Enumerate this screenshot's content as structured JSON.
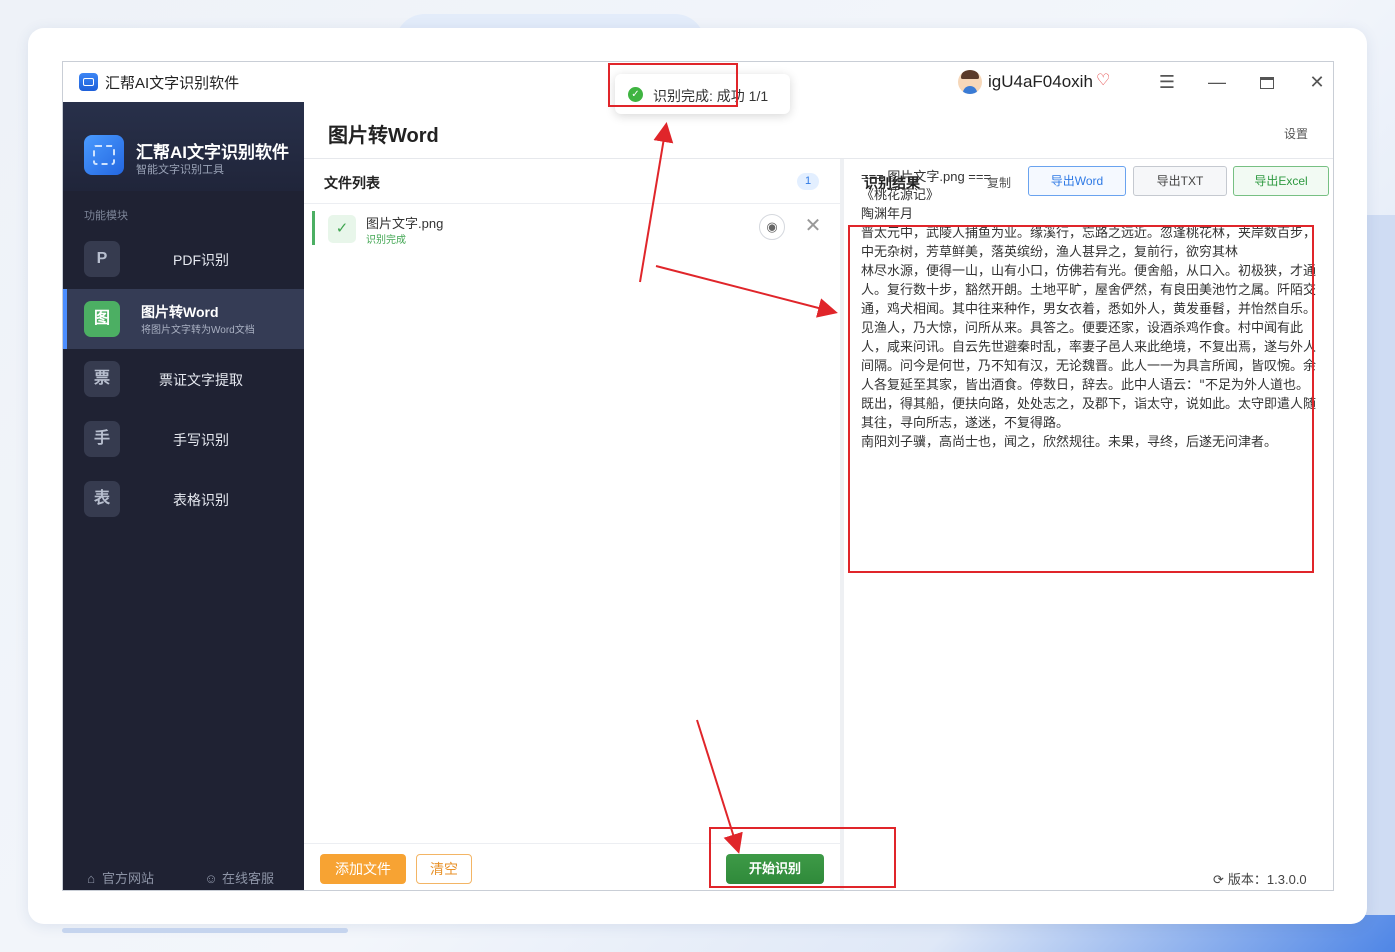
{
  "window": {
    "title": "汇帮AI文字识别软件",
    "username": "igU4aF04oxih"
  },
  "toast": {
    "text": "识别完成: 成功 1/1"
  },
  "sidebar": {
    "brand_title": "汇帮AI文字识别软件",
    "brand_subtitle": "智能文字识别工具",
    "section_label": "功能模块",
    "items": [
      {
        "badge": "P",
        "label": "PDF识别"
      },
      {
        "badge": "图",
        "label": "图片转Word",
        "sublabel": "将图片文字转为Word文档",
        "active": true
      },
      {
        "badge": "票",
        "label": "票证文字提取"
      },
      {
        "badge": "手",
        "label": "手写识别"
      },
      {
        "badge": "表",
        "label": "表格识别"
      }
    ],
    "footer": {
      "website": "官方网站",
      "support": "在线客服"
    }
  },
  "main": {
    "page_title": "图片转Word",
    "settings": "设置"
  },
  "file_list": {
    "title": "文件列表",
    "count": "1",
    "files": [
      {
        "name": "图片文字.png",
        "status": "识别完成"
      }
    ],
    "add_button": "添加文件",
    "clear_button": "清空",
    "start_button": "开始识别"
  },
  "result": {
    "title": "识别结果",
    "copy": "复制",
    "export_word": "导出Word",
    "export_txt": "导出TXT",
    "export_excel": "导出Excel",
    "lines": [
      "=== 图片文字.png ===",
      "《桃花源记》",
      "陶渊年月",
      "晋太元中，武陵人捕鱼为业。缘溪行，忘路之远近。忽逢桃花林，夹岸数百步，中无杂树，芳草鲜美，落英缤纷，渔人甚异之，复前行，欲穷其林",
      "林尽水源，便得一山，山有小口，仿佛若有光。便舍船，从口入。初极狭，才通人。复行数十步，豁然开朗。土地平旷，屋舍俨然，有良田美池竹之属。阡陌交通，鸡犬相闻。其中往来种作，男女衣着，悉如外人，黄发垂髫，并怡然自乐。",
      "见渔人，乃大惊，问所从来。具答之。便要还家，设酒杀鸡作食。村中闻有此人，咸来问讯。自云先世避秦时乱，率妻子邑人来此绝境，不复出焉，遂与外人间隔。问今是何世，乃不知有汉，无论魏晋。此人一一为具言所闻，皆叹惋。余人各复延至其家，皆出酒食。停数日，辞去。此中人语云：\"不足为外人道也。",
      "既出，得其船，便扶向路，处处志之，及郡下，诣太守，说如此。太守即遣人随其往，寻向所志，遂迷，不复得路。",
      "南阳刘子骥，高尚士也，闻之，欣然规往。未果，寻终，后遂无问津者。"
    ],
    "version": "版本：1.3.0.0"
  }
}
